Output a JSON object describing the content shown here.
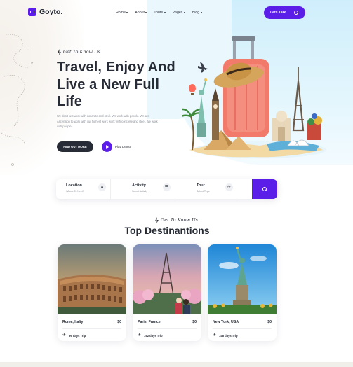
{
  "brand": {
    "name": "Goyto.",
    "accent": "#5b1de8",
    "dark": "#262b36"
  },
  "nav": {
    "items": [
      {
        "label": "Home"
      },
      {
        "label": "About"
      },
      {
        "label": "Tours"
      },
      {
        "label": "Pages"
      },
      {
        "label": "Blog"
      }
    ],
    "cta_label": "Lets Talk",
    "cta_icon": "search-icon"
  },
  "hero": {
    "kicker": "Get To Know Us",
    "title": "Travel, Enjoy And Live a New Full Life",
    "description": "We don't just work with concrete and steel. We work with people. We are Ascension to work with our highest work work with concrete and steel. We work with people.",
    "primary_button": "FIND OUT MORE",
    "play_label": "Play Demo"
  },
  "search": {
    "fields": [
      {
        "title": "Location",
        "sub": "Where To Next?",
        "icon": "location-pin-icon"
      },
      {
        "title": "Activity",
        "sub": "Select Activity",
        "icon": "activity-icon"
      },
      {
        "title": "Tour",
        "sub": "Select Type",
        "icon": "plane-icon"
      }
    ],
    "button_icon": "search-icon"
  },
  "destinations": {
    "kicker": "Get To Know Us",
    "title": "Top Destinantions",
    "cards": [
      {
        "location": "Rome, Italty",
        "price": "$0",
        "trip": "96 days Trip",
        "image": "colosseum"
      },
      {
        "location": "Paris, France",
        "price": "$0",
        "trip": "192 days Trip",
        "image": "eiffel-tower"
      },
      {
        "location": "New York, USA",
        "price": "$0",
        "trip": "148 days Trip",
        "image": "statue-of-liberty"
      }
    ]
  }
}
